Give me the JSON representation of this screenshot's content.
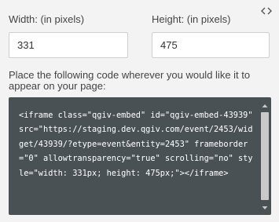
{
  "header": {
    "toggle_icon": "code-brackets-icon"
  },
  "width_field": {
    "label": "Width: (in pixels)",
    "value": "331"
  },
  "height_field": {
    "label": "Height: (in pixels)",
    "value": "475"
  },
  "instructions": "Place the following code wherever you would like it to appear on your page:",
  "embed_code": "<iframe class=\"qgiv-embed\" id=\"qgiv-embed-43939\" src=\"https://staging.dev.qgiv.com/event/2453/widget/43939/?etype=event&entity=2453\" frameborder=\"0\" allowtransparency=\"true\" scrolling=\"no\" style=\"width: 331px; height: 475px;\"></iframe>",
  "colors": {
    "background": "#f3f3f3",
    "code_background": "#4a5155",
    "code_text": "#ffffff",
    "scroll_thumb": "#c9c9c9"
  }
}
